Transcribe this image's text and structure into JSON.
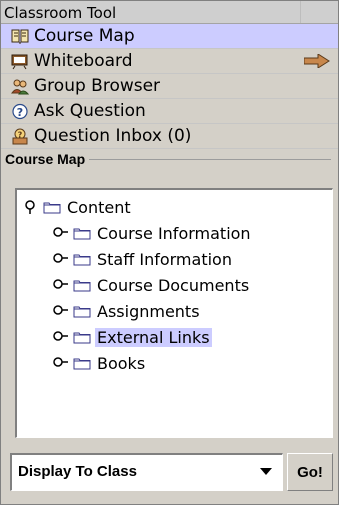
{
  "header": {
    "title": "Classroom Tool"
  },
  "menu": {
    "items": [
      {
        "label": "Course Map",
        "icon": "book-icon",
        "selected": true
      },
      {
        "label": "Whiteboard",
        "icon": "whiteboard-icon",
        "selected": false,
        "has_arrow": true
      },
      {
        "label": "Group Browser",
        "icon": "group-icon",
        "selected": false
      },
      {
        "label": "Ask Question",
        "icon": "question-icon",
        "selected": false
      },
      {
        "label": "Question Inbox (0)",
        "icon": "inbox-icon",
        "selected": false
      }
    ]
  },
  "course_map": {
    "legend": "Course Map",
    "root": {
      "label": "Content"
    },
    "children": [
      {
        "label": "Course Information",
        "selected": false
      },
      {
        "label": "Staff Information",
        "selected": false
      },
      {
        "label": "Course Documents",
        "selected": false
      },
      {
        "label": "Assignments",
        "selected": false
      },
      {
        "label": "External Links",
        "selected": true
      },
      {
        "label": "Books",
        "selected": false
      }
    ]
  },
  "controls": {
    "display_select": "Display To Class",
    "go_label": "Go!"
  },
  "colors": {
    "selection": "#ccccff",
    "panel": "#d4d0c8",
    "arrow_fill": "#c8874c"
  }
}
